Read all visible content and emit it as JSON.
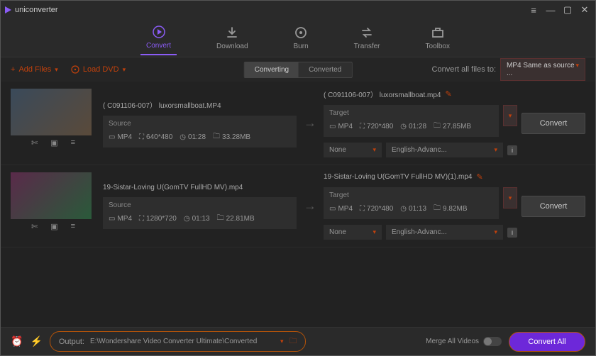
{
  "app": {
    "name": "uniconverter"
  },
  "nav": {
    "convert": "Convert",
    "download": "Download",
    "burn": "Burn",
    "transfer": "Transfer",
    "toolbox": "Toolbox"
  },
  "toolbar": {
    "add_files": "Add Files",
    "load_dvd": "Load DVD",
    "converting": "Converting",
    "converted": "Converted",
    "convert_all_to": "Convert all files to:",
    "format": "MP4 Same as source ..."
  },
  "files": [
    {
      "src_label": "( C091106-007）  luxorsmallboat.MP4",
      "tgt_label": "( C091106-007）  luxorsmallboat.mp4",
      "source_head": "Source",
      "target_head": "Target",
      "src_fmt": "MP4",
      "src_res": "640*480",
      "src_dur": "01:28",
      "src_size": "33.28MB",
      "tgt_fmt": "MP4",
      "tgt_res": "720*480",
      "tgt_dur": "01:28",
      "tgt_size": "27.85MB",
      "sub": "None",
      "audio": "English-Advanc...",
      "convert": "Convert"
    },
    {
      "src_label": "19-Sistar-Loving U(GomTV FullHD MV).mp4",
      "tgt_label": "19-Sistar-Loving U(GomTV FullHD MV)(1).mp4",
      "source_head": "Source",
      "target_head": "Target",
      "src_fmt": "MP4",
      "src_res": "1280*720",
      "src_dur": "01:13",
      "src_size": "22.81MB",
      "tgt_fmt": "MP4",
      "tgt_res": "720*480",
      "tgt_dur": "01:13",
      "tgt_size": "9.82MB",
      "sub": "None",
      "audio": "English-Advanc...",
      "convert": "Convert"
    }
  ],
  "status": {
    "output_label": "Output:",
    "output_path": "E:\\Wondershare Video Converter Ultimate\\Converted",
    "merge_label": "Merge All Videos",
    "convert_all": "Convert All"
  }
}
